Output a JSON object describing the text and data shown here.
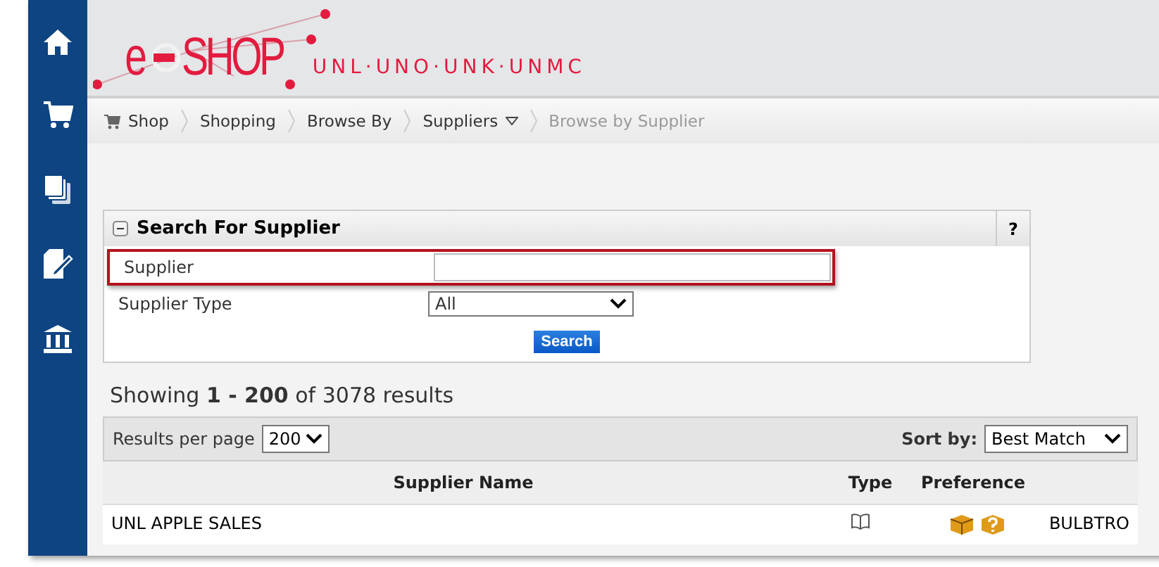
{
  "sidebar": {
    "items": [
      {
        "kind": "home"
      },
      {
        "kind": "cart"
      },
      {
        "kind": "documents"
      },
      {
        "kind": "edit"
      },
      {
        "kind": "institution"
      }
    ]
  },
  "logo": {
    "prefix": "e",
    "name": "SHOP",
    "campuses": "UNL·UNO·UNK·UNMC"
  },
  "breadcrumb": [
    {
      "label": "Shop",
      "icon": true,
      "dropdown": false,
      "current": false
    },
    {
      "label": "Shopping",
      "icon": false,
      "dropdown": false,
      "current": false
    },
    {
      "label": "Browse By",
      "icon": false,
      "dropdown": false,
      "current": false
    },
    {
      "label": "Suppliers",
      "icon": false,
      "dropdown": true,
      "current": false
    },
    {
      "label": "Browse by Supplier",
      "icon": false,
      "dropdown": false,
      "current": true
    }
  ],
  "search_panel": {
    "title": "Search For Supplier",
    "help": "?",
    "expanded": true,
    "fields": [
      {
        "kind": "text",
        "label": "Supplier",
        "highlighted": true
      },
      {
        "kind": "select",
        "label": "Supplier Type",
        "value": "All",
        "highlighted": false
      }
    ],
    "button": "Search"
  },
  "results": {
    "summary": "Showing **1 - 200** of 3078 results",
    "per_page_label": "Results per page",
    "per_page": "200",
    "sort_label": "Sort by:",
    "sort": "Best Match"
  },
  "table": {
    "columns": [
      "Supplier Name",
      "Type",
      "Preference"
    ],
    "rows": [
      {
        "cells": [
          "UNL APPLE SALES"
        ],
        "column_4": "BULBTRO"
      }
    ]
  }
}
